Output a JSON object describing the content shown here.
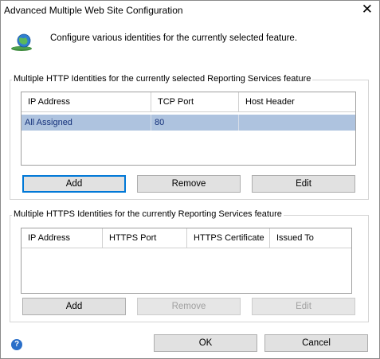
{
  "window": {
    "title": "Advanced Multiple Web Site Configuration",
    "close_glyph": "✕"
  },
  "header": {
    "icon": "globe-network-icon",
    "text": "Configure various identities for the currently selected feature."
  },
  "http_group": {
    "legend": "Multiple HTTP Identities for the currently selected Reporting Services feature",
    "columns": [
      "IP Address",
      "TCP Port",
      "Host Header"
    ],
    "rows": [
      {
        "ip": "All Assigned",
        "port": "80",
        "host": ""
      }
    ],
    "selected_row_color": "#aec3df",
    "buttons": {
      "add": "Add",
      "remove": "Remove",
      "edit": "Edit"
    }
  },
  "https_group": {
    "legend": "Multiple HTTPS Identities for the currently Reporting Services feature",
    "columns": [
      "IP Address",
      "HTTPS Port",
      "HTTPS Certificate",
      "Issued To"
    ],
    "rows": [],
    "buttons": {
      "add": "Add",
      "remove": "Remove",
      "edit": "Edit"
    }
  },
  "footer": {
    "help_icon": "help-icon",
    "help_glyph": "?",
    "ok": "OK",
    "cancel": "Cancel"
  },
  "colors": {
    "accent": "#0078d7",
    "selection": "#aec3df",
    "disabled_text": "#a0a0a0"
  }
}
